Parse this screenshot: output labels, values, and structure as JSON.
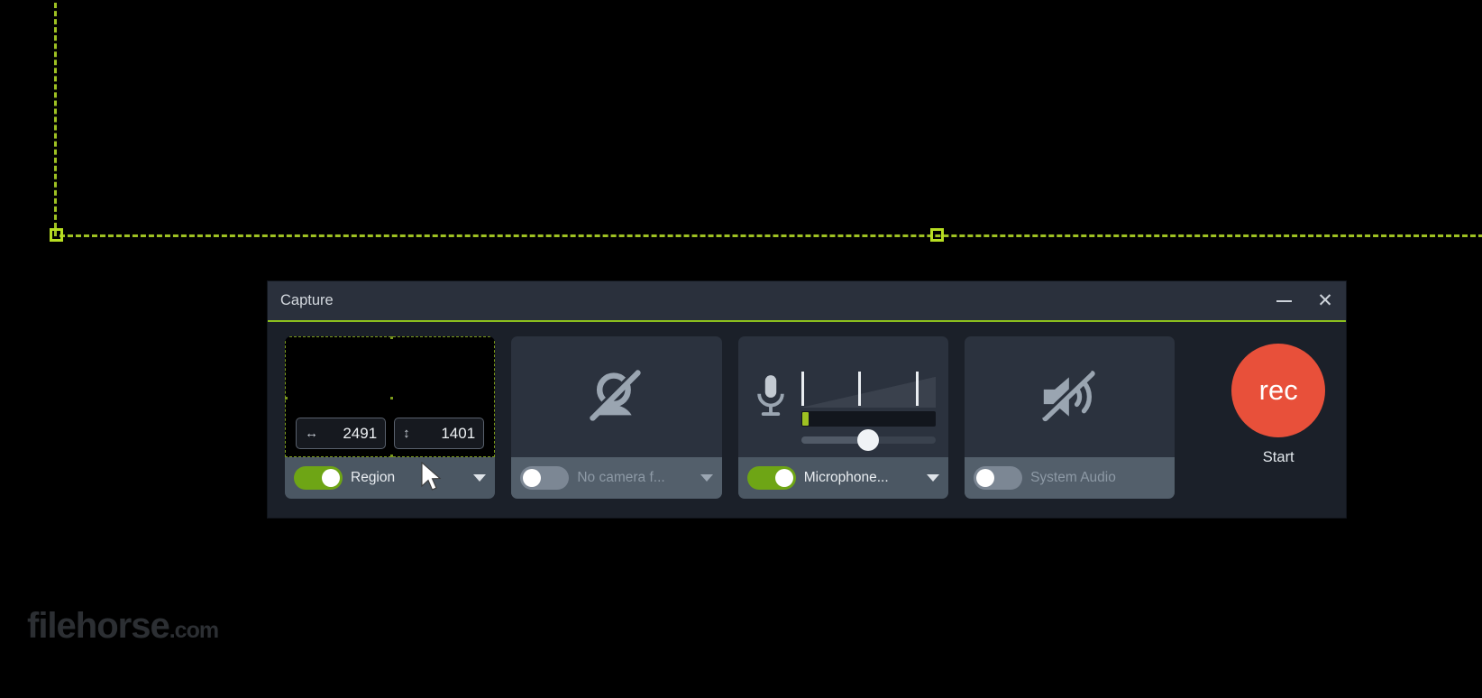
{
  "window": {
    "title": "Capture",
    "minimize_icon": "minimize-icon",
    "close_icon": "close-icon",
    "accent_color": "#8bbf1e",
    "titlebar_color": "#2a303c",
    "body_color": "#1b2029"
  },
  "selection": {
    "border_color": "#9ec122",
    "handle_color": "#b7dd22",
    "handle_count": 2
  },
  "region_panel": {
    "name": "Region",
    "toggle_on": true,
    "width_icon": "horizontal-resize-icon",
    "width_value": "2491",
    "height_icon": "vertical-resize-icon",
    "height_value": "1401",
    "caret_icon": "chevron-down-icon"
  },
  "camera_panel": {
    "name": "No camera f...",
    "toggle_on": false,
    "icon": "camera-off-icon",
    "caret_icon": "chevron-down-icon"
  },
  "microphone_panel": {
    "name": "Microphone...",
    "toggle_on": true,
    "icon": "microphone-icon",
    "level_color": "#9ec122",
    "level_percent": 4,
    "volume_percent": 50,
    "caret_icon": "chevron-down-icon"
  },
  "system_audio_panel": {
    "name": "System Audio",
    "toggle_on": false,
    "icon": "speaker-mute-icon",
    "caret_icon": "chevron-down-icon"
  },
  "record": {
    "button_text": "rec",
    "label": "Start",
    "color": "#e8503a"
  },
  "watermark": {
    "name": "filehorse",
    "suffix": ".com"
  }
}
